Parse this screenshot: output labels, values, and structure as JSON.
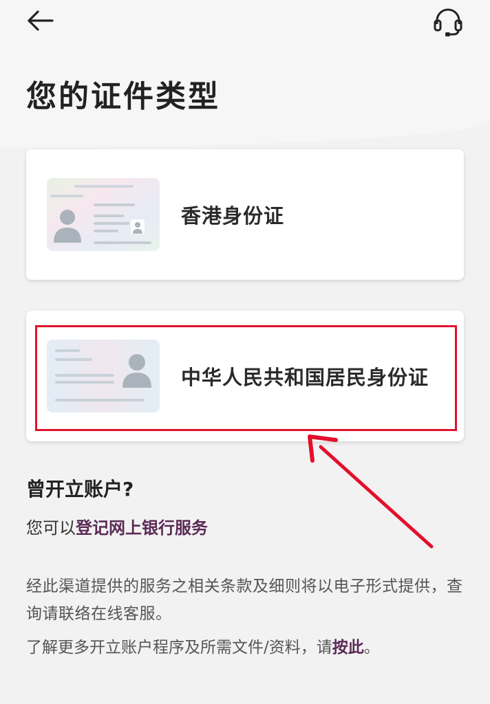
{
  "header": {
    "back_icon": "arrow-left-icon",
    "support_icon": "headset-icon"
  },
  "page_title": "您的证件类型",
  "id_options": [
    {
      "label": "香港身份证",
      "illustration": "hk-id-card-icon"
    },
    {
      "label": "中华人民共和国居民身份证",
      "illustration": "prc-id-card-icon"
    }
  ],
  "existing_account": {
    "heading": "曾开立账户?",
    "prefix": "您可以",
    "link_label": "登记网上银行服务"
  },
  "terms_text": "经此渠道提供的服务之相关条款及细则将以电子形式提供，查询请联络在线客服。",
  "more_info": {
    "prefix": "了解更多开立账户程序及所需文件/资料，请",
    "link_label": "按此",
    "suffix": "。"
  },
  "colors": {
    "accent_link": "#5b2a55",
    "highlight": "#e3102b",
    "background": "#f3f3f4",
    "card": "#ffffff"
  }
}
